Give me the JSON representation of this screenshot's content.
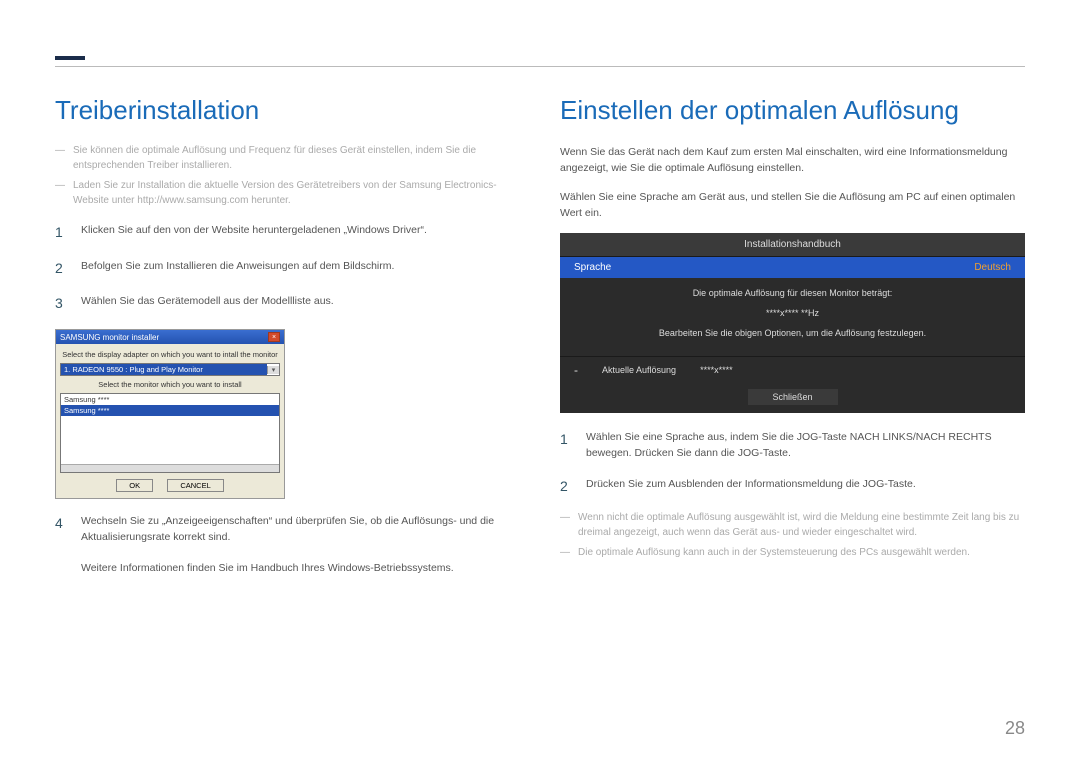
{
  "page_number": "28",
  "left": {
    "heading": "Treiberinstallation",
    "notes": [
      "Sie können die optimale Auflösung und Frequenz für dieses Gerät einstellen, indem Sie die entsprechenden Treiber installieren.",
      "Laden Sie zur Installation die aktuelle Version des Gerätetreibers von der Samsung Electronics-Website unter http://www.samsung.com herunter."
    ],
    "steps": {
      "s1": "Klicken Sie auf den von der Website heruntergeladenen „Windows Driver“.",
      "s2": "Befolgen Sie zum Installieren die Anweisungen auf dem Bildschirm.",
      "s3": "Wählen Sie das Gerätemodell aus der Modellliste aus.",
      "s4": "Wechseln Sie zu „Anzeigeeigenschaften“ und überprüfen Sie, ob die Auflösungs- und die Aktualisierungsrate korrekt sind."
    },
    "footer": "Weitere Informationen finden Sie im Handbuch Ihres Windows-Betriebssystems.",
    "installer": {
      "title": "SAMSUNG monitor installer",
      "label1": "Select the display adapter on which you want to intall the monitor",
      "select_value": "1. RADEON 9550 : Plug and Play Monitor",
      "label2": "Select the monitor which you want to install",
      "list_item1": "Samsung ****",
      "list_item2": "Samsung ****",
      "ok": "OK",
      "cancel": "CANCEL"
    }
  },
  "right": {
    "heading": "Einstellen der optimalen Auflösung",
    "para1": "Wenn Sie das Gerät nach dem Kauf zum ersten Mal einschalten, wird eine Informationsmeldung angezeigt, wie Sie die optimale Auflösung einstellen.",
    "para2": "Wählen Sie eine Sprache am Gerät aus, und stellen Sie die Auflösung am PC auf einen optimalen Wert ein.",
    "osd": {
      "title": "Installationshandbuch",
      "lang_label": "Sprache",
      "lang_value": "Deutsch",
      "line1": "Die optimale Auflösung für diesen Monitor beträgt:",
      "line2": "****x**** **Hz",
      "line3": "Bearbeiten Sie die obigen Optionen, um die Auflösung festzulegen.",
      "current_label": "Aktuelle Auflösung",
      "current_value": "****x****",
      "close": "Schließen"
    },
    "steps": {
      "s1": "Wählen Sie eine Sprache aus, indem Sie die JOG-Taste NACH LINKS/NACH RECHTS bewegen. Drücken Sie dann die JOG-Taste.",
      "s2": "Drücken Sie zum Ausblenden der Informationsmeldung die JOG-Taste."
    },
    "notes": [
      "Wenn nicht die optimale Auflösung ausgewählt ist, wird die Meldung eine bestimmte Zeit lang bis zu dreimal angezeigt, auch wenn das Gerät aus- und wieder eingeschaltet wird.",
      "Die optimale Auflösung kann auch in der Systemsteuerung des PCs ausgewählt werden."
    ]
  }
}
